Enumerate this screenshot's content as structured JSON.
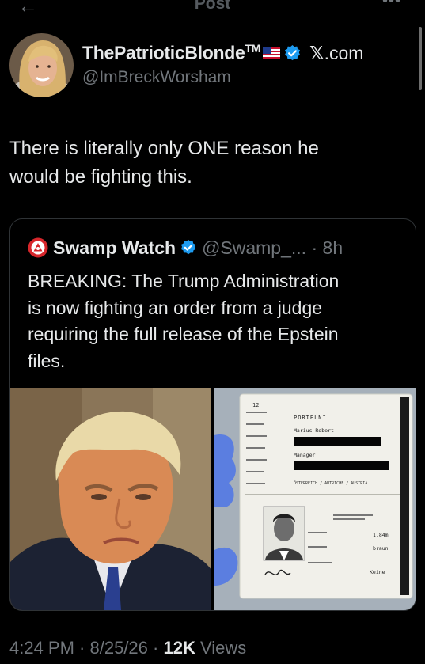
{
  "topbar": {
    "title": "Post"
  },
  "author": {
    "display_name": "ThePatrioticBlonde",
    "tm": "TM",
    "x_logo": "𝕏",
    "x_domain": ".com",
    "handle": "@ImBreckWorsham"
  },
  "tweet": {
    "text_line1": "There is literally only ONE reason he",
    "text_line2": "would be fighting this."
  },
  "quote": {
    "name": "Swamp Watch",
    "handle": "@Swamp_...",
    "time": "8h",
    "text_lines": [
      "BREAKING: The Trump Administration",
      "is now fighting an order from a judge",
      "requiring the full release of the Epstein",
      "files."
    ],
    "passport": {
      "surname": "PORTELNI",
      "given_name": "Marius Robert",
      "profession": "Manager",
      "country": "ÖSTERREICH / AUTRICHE / AUSTRIA",
      "height": "1,84m",
      "eyes": "braun",
      "special": "Keine"
    }
  },
  "footer": {
    "time": "4:24 PM",
    "date": "8/25/26",
    "views_count": "12K",
    "views_label": "Views"
  },
  "colors": {
    "background": "#000000",
    "text": "#e7e9ea",
    "secondary": "#71767b",
    "verified": "#1d9bf0",
    "border": "#2f3336"
  }
}
